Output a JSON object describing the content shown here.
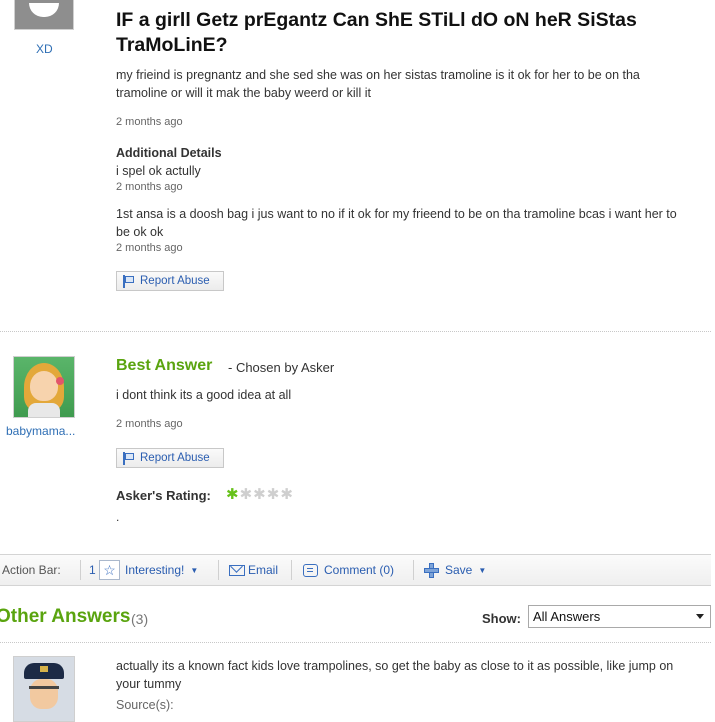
{
  "question": {
    "user": "XD",
    "title": "IF a girll Getz prEgantz Can ShE STiLl dO oN heR SiStas TraMoLinE?",
    "body": "my frieind is pregnantz and she sed she was on her sistas tramoline is it ok for her to be on tha tramoline or will it mak the baby weerd or kill it",
    "time": "2 months ago",
    "additional_details_title": "Additional Details",
    "details": [
      {
        "text": "i spel ok actully",
        "time": "2 months ago"
      },
      {
        "text": "1st ansa is a doosh bag i jus want to no if it ok for my frieend to be on tha tramoline bcas i want her to be ok ok",
        "time": "2 months ago"
      }
    ],
    "report_label": "Report Abuse"
  },
  "best_answer": {
    "heading": "Best Answer",
    "chosen": "- Chosen by Asker",
    "user": "babymama...",
    "body": "i dont think its a good idea at all",
    "time": "2 months ago",
    "report_label": "Report Abuse",
    "rating_label": "Asker's Rating:",
    "rating": 1,
    "rating_max": 5,
    "trailing": "."
  },
  "action_bar": {
    "label": "Action Bar:",
    "interesting_count": "1",
    "interesting_label": "Interesting!",
    "email_label": "Email",
    "comment_label": "Comment (0)",
    "save_label": "Save"
  },
  "other_answers": {
    "heading": "Other Answers",
    "count": "(3)",
    "show_label": "Show:",
    "show_value": "All Answers",
    "first": {
      "body": "actually its a known fact kids love trampolines, so get the baby as close to it as possible, like jump on your tummy",
      "source_label": "Source(s):"
    }
  },
  "colors": {
    "accent_green": "#5aa40f",
    "link_blue": "#2f6fb5",
    "star_on": "#66c11a",
    "star_off": "#cfcfcf"
  }
}
